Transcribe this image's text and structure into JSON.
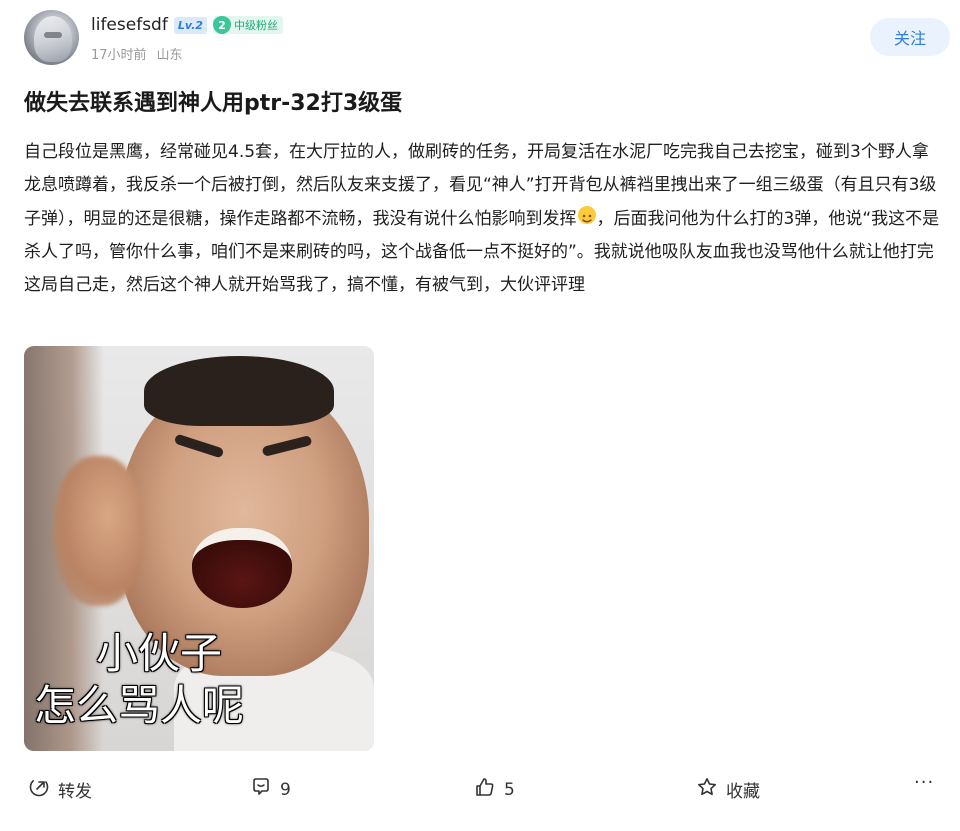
{
  "user": {
    "name": "lifesefsdf",
    "level_badge": "Lv.2",
    "fan_badge_num": "2",
    "fan_badge_label": "中级粉丝",
    "time": "17小时前",
    "location": "山东",
    "follow_label": "关注"
  },
  "post": {
    "title": "做失去联系遇到神人用ptr-32打3级蛋",
    "body_part1": "自己段位是黑鹰，经常碰见4.5套，在大厅拉的人，做刷砖的任务，开局复活在水泥厂吃完我自己去挖宝，碰到3个野人拿龙息喷蹲着，我反杀一个后被打倒，然后队友来支援了，看见“神人”打开背包从裤裆里拽出来了一组三级蛋（有且只有3级子弹），明显的还是很糖，操作走路都不流畅，我没有说什么怕影响到发挥",
    "body_part2": "，后面我问他为什么打的3弹，他说“我这不是杀人了吗，管你什么事，咱们不是来刷砖的吗，这个战备低一点不挺好的”。我就说他吸队友血我也没骂他什么就让他打完这局自己走，然后这个神人就开始骂我了，搞不懂，有被气到，大伙评评理",
    "image_caption_line1": "小伙子",
    "image_caption_line2": "怎么骂人呢"
  },
  "actions": {
    "forward_label": "转发",
    "comment_count": "9",
    "like_count": "5",
    "favorite_label": "收藏",
    "more_label": "···"
  },
  "colors": {
    "accent": "#2f7de0",
    "follow_bg": "#eaf2fd",
    "fan_green": "#21a877"
  },
  "icons": [
    "forward-icon",
    "comment-icon",
    "like-icon",
    "favorite-icon",
    "more-icon",
    "smile-emoji-icon"
  ]
}
